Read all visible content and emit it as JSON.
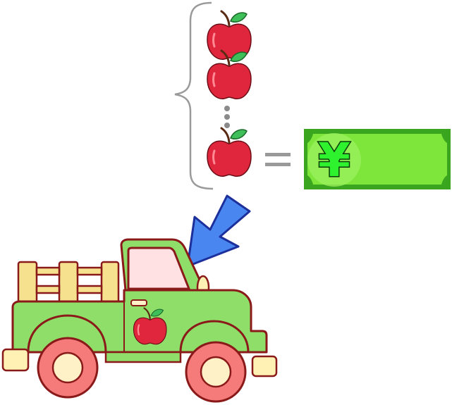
{
  "banknote": {
    "symbol": "¥",
    "note_color": "#7ee63a",
    "border_color": "#3aa51f",
    "symbol_color": "#2df22d"
  },
  "apple_stack": {
    "apple_color": "#e0263c",
    "leaf_color": "#3fbf5a",
    "ellipsis_color": "#8a8a8a"
  },
  "equals_sign": {
    "color": "#999999"
  },
  "arrow": {
    "color": "#4a86f0",
    "outline": "#1c2f9a"
  },
  "truck": {
    "body_color": "#8fde6a",
    "outline_color": "#8a1a1a",
    "window_color": "#ffe1e4",
    "wheel_color": "#f57a7a",
    "hub_color": "#fff1c7",
    "rail_color": "#f6e28e",
    "bumper_color": "#fff1b3"
  }
}
